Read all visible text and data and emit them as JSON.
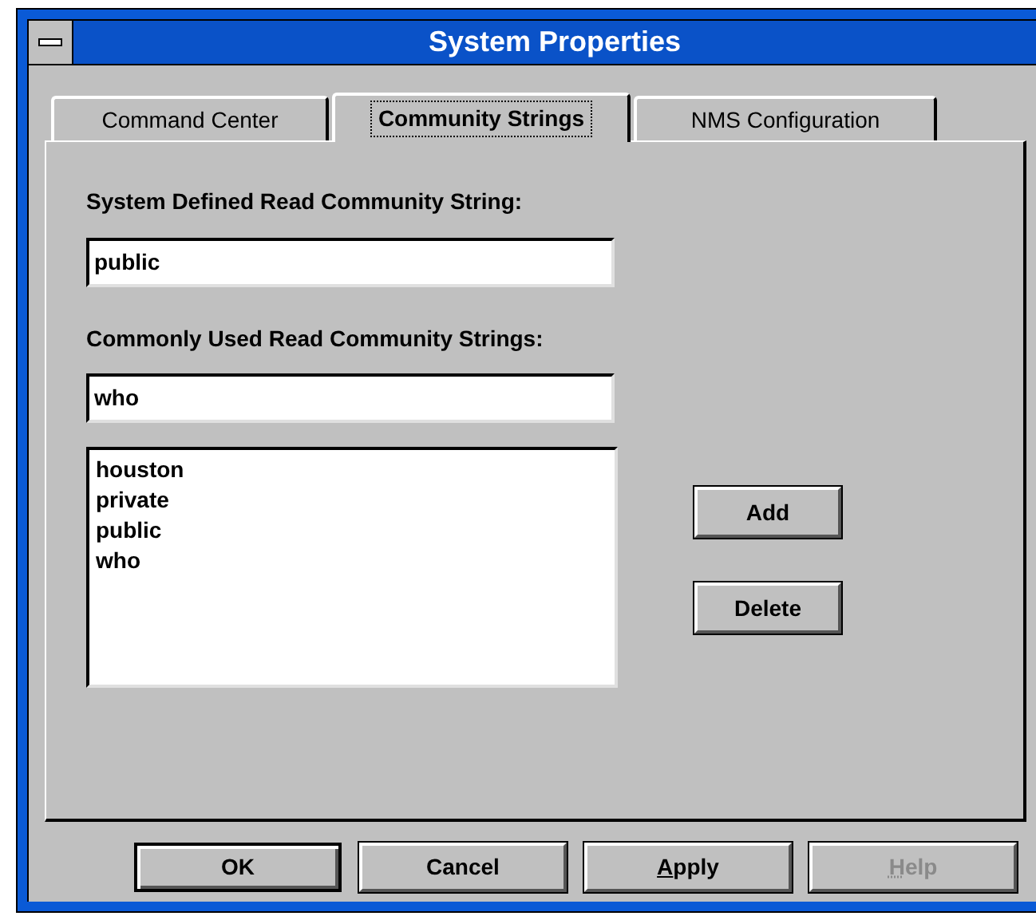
{
  "window": {
    "title": "System Properties"
  },
  "tabs": [
    {
      "label": "Command Center",
      "selected": false
    },
    {
      "label": "Community Strings",
      "selected": true
    },
    {
      "label": "NMS Configuration",
      "selected": false
    }
  ],
  "system_defined": {
    "label": "System Defined Read Community String:",
    "value": "public"
  },
  "commonly_used": {
    "label": "Commonly Used Read Community Strings:",
    "value": "who",
    "items": [
      "houston",
      "private",
      "public",
      "who"
    ]
  },
  "side_buttons": [
    {
      "label": "Add"
    },
    {
      "label": "Delete"
    }
  ],
  "buttons": [
    {
      "label": "OK",
      "default": true,
      "disabled": false,
      "mnemonic": false
    },
    {
      "label": "Cancel",
      "default": false,
      "disabled": false,
      "mnemonic": false
    },
    {
      "label": "Apply",
      "default": false,
      "disabled": false,
      "mnemonic": true
    },
    {
      "label": "Help",
      "default": false,
      "disabled": true,
      "mnemonic": true
    }
  ]
}
